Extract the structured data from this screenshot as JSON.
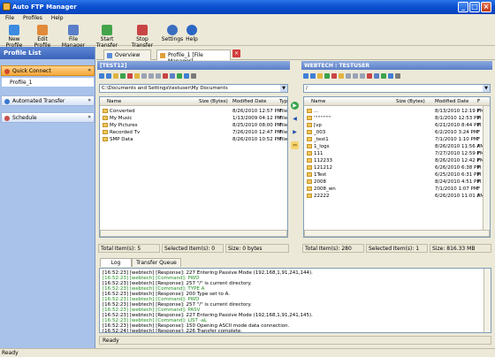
{
  "app": {
    "title": "Auto FTP Manager"
  },
  "menu": [
    "File",
    "Profiles",
    "Help"
  ],
  "toolbar": {
    "buttons": [
      {
        "label": "New Profile",
        "icon": "new-profile-icon"
      },
      {
        "label": "Edit Profile",
        "icon": "edit-profile-icon"
      },
      {
        "label": "File Manager",
        "icon": "file-manager-icon"
      },
      {
        "label": "Start Transfer",
        "icon": "start-transfer-icon"
      },
      {
        "label": "Stop Transfer",
        "icon": "stop-transfer-icon"
      },
      {
        "label": "Settings",
        "icon": "gear-icon"
      },
      {
        "label": "Help",
        "icon": "help-icon"
      }
    ]
  },
  "sidebar": {
    "title": "Profile List",
    "sections": [
      {
        "label": "Quick Connect",
        "active": true
      },
      {
        "label": "Automated Transfer",
        "active": false
      },
      {
        "label": "Schedule",
        "active": false
      }
    ],
    "profile_item": "Profile_1"
  },
  "tabs": [
    {
      "label": "Overview"
    },
    {
      "label": "Profile_1 [File Manager]"
    }
  ],
  "local": {
    "title": "[TEST12]",
    "path": "C:\\Documents and Settings\\testuser\\My Documents",
    "columns": [
      "Name",
      "Size (Bytes)",
      "Modified Date",
      "Typ"
    ],
    "rows": [
      {
        "name": "Converted",
        "size": "",
        "date": "8/26/2010 12:57 PM",
        "type": "File F"
      },
      {
        "name": "My Music",
        "size": "",
        "date": "1/13/2009 04:12 PM",
        "type": "File F"
      },
      {
        "name": "My Pictures",
        "size": "",
        "date": "8/25/2010 08:00 PM",
        "type": "File F"
      },
      {
        "name": "Recorded Tv",
        "size": "",
        "date": "7/26/2010 12:47 PM",
        "type": "File F"
      },
      {
        "name": "SMP Data",
        "size": "",
        "date": "8/26/2010 10:52 PM",
        "type": "File F"
      }
    ],
    "status": {
      "total": "Total Item(s): 5",
      "selected": "Selected Item(s): 0",
      "size": "Size: 0 bytes"
    }
  },
  "remote": {
    "title": "WEBTECH : TESTUSER",
    "path": "/",
    "columns": [
      "Name",
      "Size (Bytes)",
      "Modified Date",
      "F"
    ],
    "rows": [
      {
        "name": "...",
        "date": "8/13/2010 12:19 PM",
        "type": "F"
      },
      {
        "name": "'''''''''''''",
        "date": "8/1/2010 12:53 PM",
        "type": "F"
      },
      {
        "name": "[vp",
        "date": "6/21/2010 8:44 PM",
        "type": "F"
      },
      {
        "name": "_003",
        "date": "6/2/2010 3:24 PM",
        "type": "F"
      },
      {
        "name": "_test1",
        "date": "7/1/2010 1:10 PM",
        "type": "F"
      },
      {
        "name": "1_logs",
        "date": "8/26/2010 11:56 AM",
        "type": "F"
      },
      {
        "name": "111",
        "date": "7/27/2010 12:59 PM",
        "type": "F"
      },
      {
        "name": "112233",
        "date": "8/26/2010 12:42 PM",
        "type": "F"
      },
      {
        "name": "121212",
        "date": "6/26/2010 6:38 PM",
        "type": "F"
      },
      {
        "name": "1Test",
        "date": "6/25/2010 6:31 PM",
        "type": "F"
      },
      {
        "name": "2008",
        "date": "8/24/2010 4:51 PM",
        "type": "F"
      },
      {
        "name": "2008_wn",
        "date": "7/1/2010 1:07 PM",
        "type": "F"
      },
      {
        "name": "22222",
        "date": "6/26/2010 11:01 AM",
        "type": "F"
      }
    ],
    "status": {
      "total": "Total Item(s): 280",
      "selected": "Selected Item(s): 1",
      "size": "Size: 816.33 MB"
    }
  },
  "log": {
    "tabs": [
      "Log",
      "Transfer Queue"
    ],
    "lines": [
      {
        "text": "[16:52:23] [webtech] [Response]: 227 Entering Passive Mode (192,168,1,91,241,144).",
        "cmd": false
      },
      {
        "text": "[16:52:23] [webtech] [Command]: PWD",
        "cmd": true
      },
      {
        "text": "[16:52:23] [webtech] [Response]: 257 \"/\" is current directory.",
        "cmd": false
      },
      {
        "text": "[16:52:23] [webtech] [Command]: TYPE A",
        "cmd": true
      },
      {
        "text": "[16:52:23] [webtech] [Response]: 200 Type set to A.",
        "cmd": false
      },
      {
        "text": "[16:52:23] [webtech] [Command]: PWD",
        "cmd": true
      },
      {
        "text": "[16:52:23] [webtech] [Response]: 257 \"/\" is current directory.",
        "cmd": false
      },
      {
        "text": "[16:52:23] [webtech] [Command]: PASV",
        "cmd": true
      },
      {
        "text": "[16:52:23] [webtech] [Response]: 227 Entering Passive Mode (192,168,1,91,241,145).",
        "cmd": false
      },
      {
        "text": "[16:52:23] [webtech] [Command]: LIST -aL",
        "cmd": true
      },
      {
        "text": "[16:52:23] [webtech] [Response]: 150 Opening ASCII mode data connection.",
        "cmd": false
      },
      {
        "text": "[16:52:24] [webtech] [Response]: 226 Transfer complete.",
        "cmd": false
      }
    ],
    "status": "Ready"
  },
  "statusbar": "Ready"
}
